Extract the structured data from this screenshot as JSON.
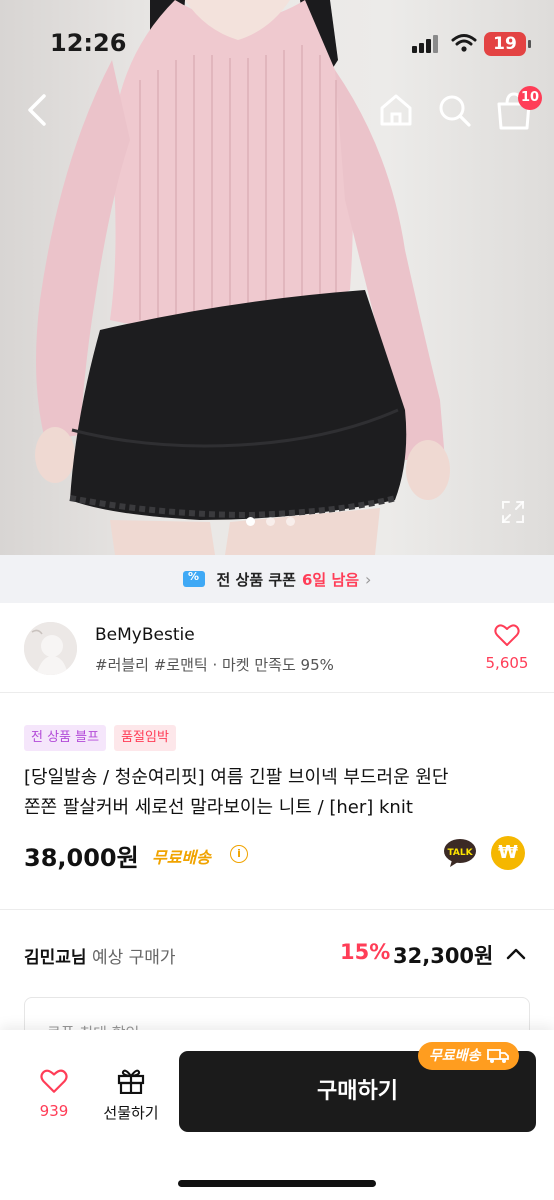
{
  "status_bar": {
    "time": "12:26",
    "battery": "19"
  },
  "header": {
    "cart_count": "10"
  },
  "gallery": {
    "pages": 3,
    "current": 1
  },
  "coupon_banner": {
    "prefix": "전 상품 쿠폰",
    "days": "6일 남음",
    "chevron": "›"
  },
  "seller": {
    "name": "BeMyBestie",
    "tags": "#러블리 #로맨틱 · 마켓 만족도 95%",
    "likes": "5,605"
  },
  "product": {
    "badges": [
      "전 상품 블프",
      "품절임박"
    ],
    "title_line1": "[당일발송 / 청순여리핏] 여름 긴팔 브이넥 부드러운 원단",
    "title_line2": "쫀쫀 팔살커버 세로선 말라보이는 니트 / [her] knit",
    "price": "38,000원",
    "free_shipping": "무료배송",
    "info": "i",
    "talk_label": "TALK",
    "won_symbol": "₩"
  },
  "expected": {
    "user": "김민교님",
    "label": " 예상 구매가",
    "discount": "15%",
    "price": "32,300원",
    "coupon_label": "쿠폰 최대 할인"
  },
  "bottom_bar": {
    "wish_count": "939",
    "gift_label": "선물하기",
    "buy_label": "구매하기",
    "free_ship_pill": "무료배송"
  },
  "colors": {
    "accent": "#ff3d57",
    "gold": "#f0a300",
    "buy_button": "#1b1b1b",
    "ship_pill": "#ff9d1f"
  }
}
